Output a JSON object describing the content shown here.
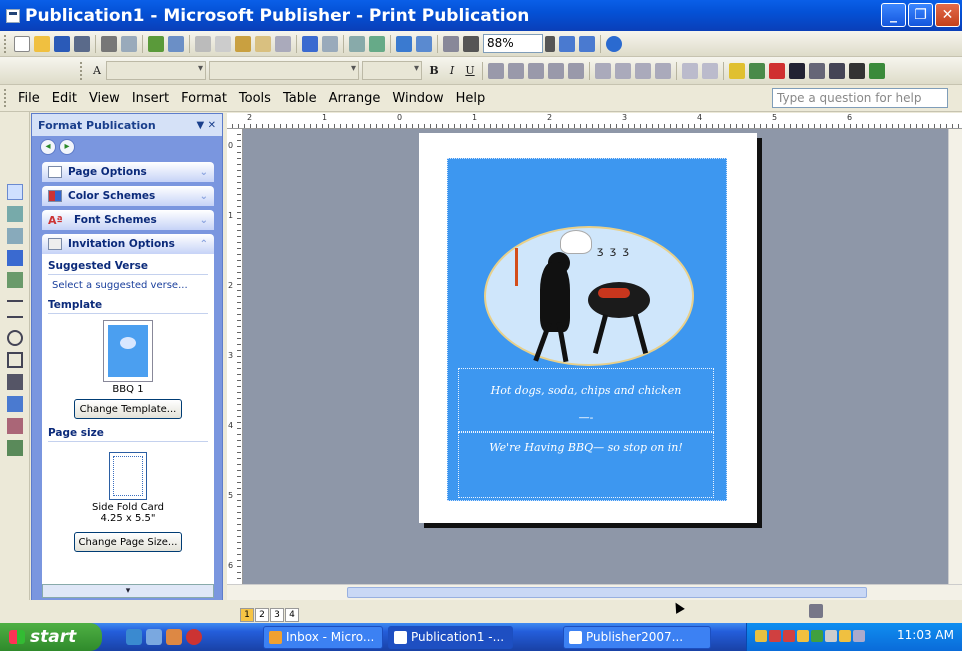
{
  "window": {
    "title": "Publication1 - Microsoft Publisher - Print Publication",
    "min_glyph": "_",
    "max_glyph": "❐",
    "close_glyph": "✕"
  },
  "toolbar": {
    "zoom": "88%",
    "font_size_glyph": "A",
    "bold": "B",
    "italic": "I",
    "underline": "U"
  },
  "menu": {
    "items": [
      "File",
      "Edit",
      "View",
      "Insert",
      "Format",
      "Tools",
      "Table",
      "Arrange",
      "Window",
      "Help"
    ],
    "help_placeholder": "Type a question for help"
  },
  "taskpane": {
    "title": "Format Publication",
    "sections": {
      "page_options": "Page Options",
      "color_schemes": "Color Schemes",
      "font_schemes": "Font Schemes",
      "invitation_options": "Invitation Options"
    },
    "suggested_verse_label": "Suggested Verse",
    "suggested_verse_link": "Select a suggested verse...",
    "template_label": "Template",
    "template_name": "BBQ 1",
    "change_template": "Change Template...",
    "page_size_label": "Page size",
    "page_size_name": "Side Fold Card",
    "page_size_dims": "4.25 x 5.5\"",
    "change_page_size": "Change Page Size..."
  },
  "rulers": {
    "h": [
      "2",
      "1",
      "0",
      "1",
      "2",
      "3",
      "4",
      "5",
      "6"
    ],
    "v": [
      "0",
      "1",
      "2",
      "3",
      "4",
      "5",
      "6"
    ]
  },
  "card": {
    "line1": "Hot dogs, soda, chips and chicken",
    "line2": "—-",
    "line3": "We're Having BBQ— so stop on in!"
  },
  "pages": [
    "1",
    "2",
    "3",
    "4"
  ],
  "taskbar": {
    "start": "start",
    "tasks": [
      "Inbox - Micro...",
      "Publication1 -...",
      "Publisher2007..."
    ],
    "clock": "11:03 AM"
  },
  "colors": {
    "card_blue": "#3d97f0",
    "workspace": "#8e97a8",
    "taskbar": "#245edb",
    "start": "#2f8a2b"
  }
}
